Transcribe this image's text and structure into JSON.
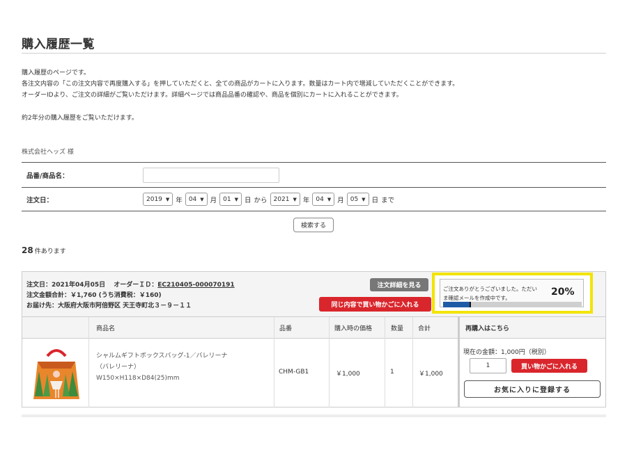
{
  "page": {
    "title": "購入履歴一覧",
    "intro_lines": [
      "購入履歴のページです。",
      "各注文内容の「この注文内容で再度購入する」を押していただくと、全ての商品がカートに入ります。数量はカート内で増減していただくことができます。",
      "オーダーIDより、ご注文の詳細がご覧いただけます。詳細ページでは商品品番の確認や、商品を個別にカートに入れることができます。"
    ],
    "note": "約2年分の購入履歴をご覧いただけます。",
    "customer": "株式会社ヘッズ 様"
  },
  "search": {
    "product_label": "品番/商品名：",
    "product_value": "",
    "date_label": "注文日：",
    "from": {
      "year": "2019",
      "month": "04",
      "day": "01"
    },
    "to": {
      "year": "2021",
      "month": "04",
      "day": "05"
    },
    "year_unit": "年",
    "month_unit": "月",
    "day_unit": "日",
    "from_word": "から",
    "to_word": "まで",
    "button": "検索する"
  },
  "results": {
    "count": "28",
    "suffix": "件あります"
  },
  "order": {
    "date_line": "注文日：2021年04月05日　 オーダーＩＤ：",
    "order_id": "EC210405-000070191",
    "total_line": "注文金額合計：￥1,760 (うち消費税：￥160)",
    "delivery_line": "お届け先：大阪府大阪市阿倍野区 天王寺町北３－９－１１",
    "detail_button": "注文詳細を見る",
    "reorder_button": "同じ内容で買い物かごに入れる",
    "columns": [
      "商品名",
      "品番",
      "購入時の価格",
      "数量",
      "合計"
    ],
    "item": {
      "name_lines": [
        "シャルムギフトボックスバッグ-1／バレリーナ",
        "（バレリーナ）",
        "W150×H118×D84(25)mm"
      ],
      "sku": "CHM-GB1",
      "price": "￥1,000",
      "quantity": "1",
      "total": "￥1,000"
    },
    "reorder_panel": {
      "heading": "再購入はこちら",
      "current_price": "現在の金額：1,000円（税別）",
      "quantity": "1",
      "cart_button": "買い物かごに入れる",
      "favorite_button": "お気に入りに登録する"
    }
  },
  "toast": {
    "message": "ご注文ありがとうございました。ただいま確認メールを作成中です。",
    "percent_label": "20%",
    "progress": 0.2
  },
  "colors": {
    "accent_red": "#d9262c",
    "highlight_yellow": "#f2e400",
    "progress_blue": "#1f5aa6",
    "detail_gray": "#777777"
  }
}
